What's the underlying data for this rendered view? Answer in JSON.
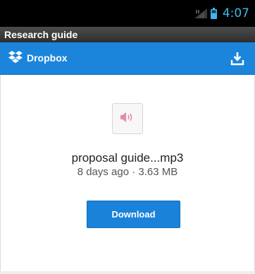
{
  "status_bar": {
    "time": "4:07",
    "icons": [
      "signal-icon",
      "battery-icon"
    ],
    "time_color": "#3fb6e8"
  },
  "activity": {
    "title": "Research guide"
  },
  "app_bar": {
    "brand": "Dropbox",
    "logo_icon": "dropbox-logo-icon",
    "action_icon": "export-icon",
    "color": "#1b85dc"
  },
  "file": {
    "name": "proposal guide...mp3",
    "modified": "8 days ago",
    "separator": "·",
    "size": "3.63 MB",
    "thumb_icon": "audio-file-icon"
  },
  "actions": {
    "download_label": "Download"
  }
}
